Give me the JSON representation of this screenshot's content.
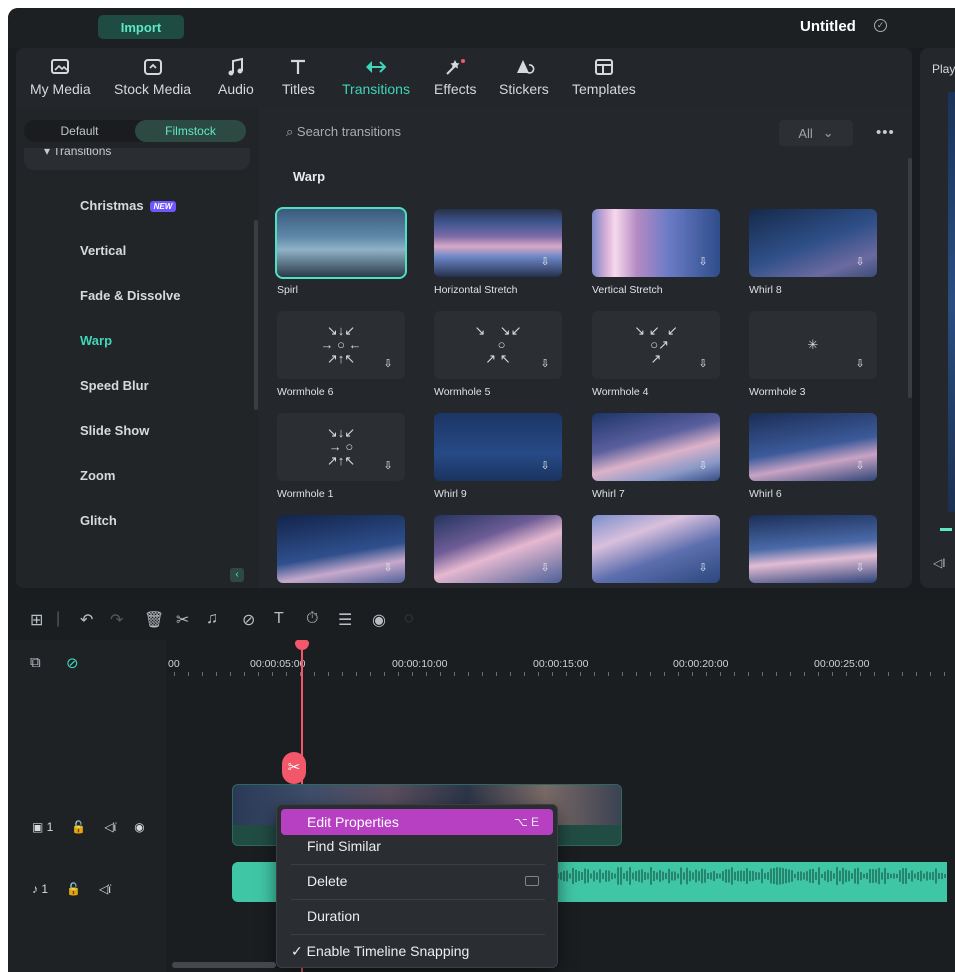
{
  "app": {
    "import_label": "Import",
    "project_title": "Untitled"
  },
  "tabs": [
    {
      "label": "My Media",
      "icon": "my-media-icon"
    },
    {
      "label": "Stock Media",
      "icon": "stock-media-icon"
    },
    {
      "label": "Audio",
      "icon": "audio-icon"
    },
    {
      "label": "Titles",
      "icon": "titles-icon"
    },
    {
      "label": "Transitions",
      "icon": "transitions-icon",
      "active": true
    },
    {
      "label": "Effects",
      "icon": "effects-icon"
    },
    {
      "label": "Stickers",
      "icon": "stickers-icon"
    },
    {
      "label": "Templates",
      "icon": "templates-icon"
    }
  ],
  "sidebar": {
    "segment": [
      "Default",
      "Filmstock"
    ],
    "group_header": "Transitions",
    "categories": [
      {
        "label": "Christmas",
        "badge": "NEW"
      },
      {
        "label": "Vertical"
      },
      {
        "label": "Fade & Dissolve"
      },
      {
        "label": "Warp",
        "active": true
      },
      {
        "label": "Speed Blur"
      },
      {
        "label": "Slide Show"
      },
      {
        "label": "Zoom"
      },
      {
        "label": "Glitch"
      }
    ]
  },
  "browser": {
    "search_placeholder": "Search transitions",
    "filter_value": "All",
    "section_title": "Warp",
    "items": [
      {
        "label": "Spirl",
        "style": "sky"
      },
      {
        "label": "Horizontal Stretch",
        "style": "hs"
      },
      {
        "label": "Vertical Stretch",
        "style": "vs"
      },
      {
        "label": "Whirl 8",
        "style": "wh"
      },
      {
        "label": "Wormhole 6",
        "style": "icon"
      },
      {
        "label": "Wormhole 5",
        "style": "icon"
      },
      {
        "label": "Wormhole 4",
        "style": "icon"
      },
      {
        "label": "Wormhole 3",
        "style": "icon"
      },
      {
        "label": "Wormhole 1",
        "style": "icon"
      },
      {
        "label": "Whirl 9",
        "style": "w9"
      },
      {
        "label": "Whirl 7",
        "style": "w7"
      },
      {
        "label": "Whirl 6",
        "style": "w6"
      },
      {
        "label": "",
        "style": "a"
      },
      {
        "label": "",
        "style": "b"
      },
      {
        "label": "",
        "style": "c"
      },
      {
        "label": "",
        "style": "d"
      }
    ]
  },
  "player": {
    "label": "Play"
  },
  "timeline": {
    "ruler_labels": [
      "00",
      "00:00:05:00",
      "00:00:10:00",
      "00:00:15:00",
      "00:00:20:00",
      "00:00:25:00"
    ],
    "video_track": "1",
    "audio_track": "1"
  },
  "context_menu": {
    "items": [
      {
        "label": "Edit Properties",
        "shortcut": "⌥ E",
        "highlighted": true
      },
      {
        "label": "Find Similar"
      },
      {
        "label": "Delete"
      },
      {
        "label": "Duration"
      },
      {
        "label": "✓ Enable Timeline Snapping"
      }
    ]
  },
  "colors": {
    "accent": "#3fd6b9",
    "highlight": "#b63fc2",
    "playhead": "#f2586a",
    "audio_clip": "#3fc6a5"
  }
}
